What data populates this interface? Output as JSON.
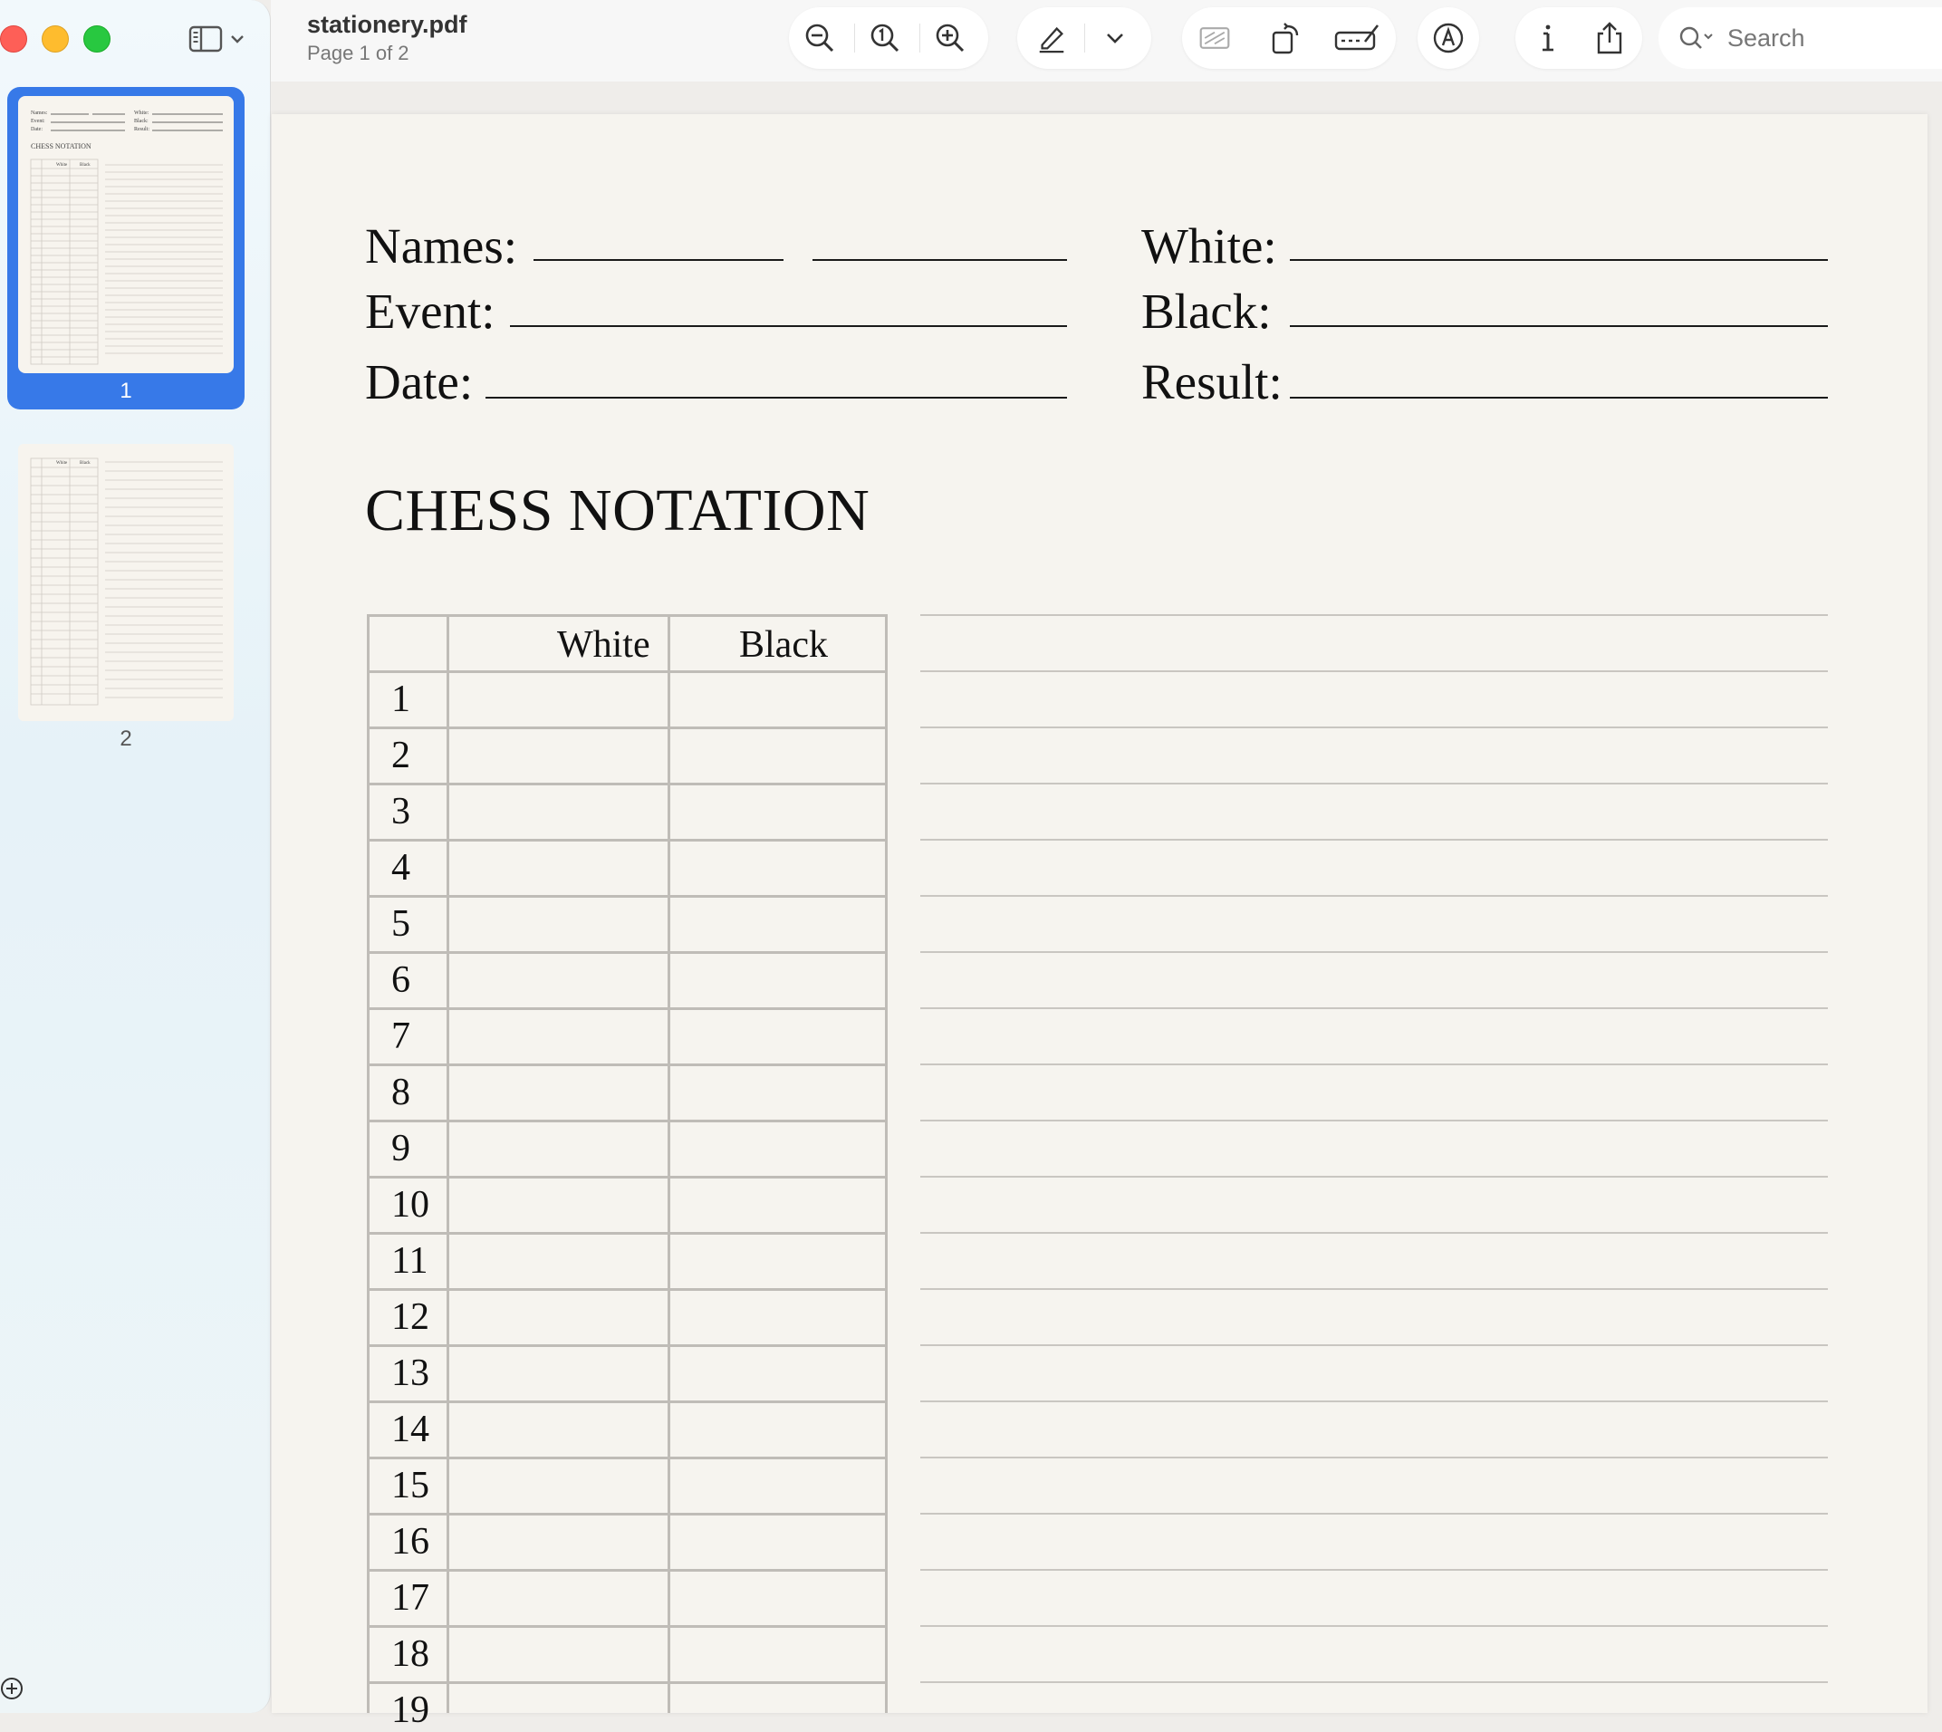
{
  "toolbar": {
    "file_name": "stationery.pdf",
    "page_indicator": "Page 1 of 2",
    "search_placeholder": "Search",
    "icons": [
      "zoom-out-icon",
      "actual-size-icon",
      "zoom-in-icon",
      "highlight-pen-icon",
      "chevron-down-icon",
      "crop-icon",
      "rotate-icon",
      "form-fill-icon",
      "markup-icon",
      "info-icon",
      "share-icon",
      "search-icon"
    ]
  },
  "sidebar": {
    "thumbnails": [
      {
        "label": "1",
        "selected": true
      },
      {
        "label": "2",
        "selected": false
      }
    ]
  },
  "page": {
    "fields_left": [
      {
        "label": "Names:"
      },
      {
        "label": "Event:"
      },
      {
        "label": "Date:"
      }
    ],
    "fields_right": [
      {
        "label": "White:"
      },
      {
        "label": "Black:"
      },
      {
        "label": "Result:"
      }
    ],
    "heading": "CHESS NOTATION",
    "table": {
      "columns": [
        "",
        "White",
        "Black"
      ],
      "rows": [
        "1",
        "2",
        "3",
        "4",
        "5",
        "6",
        "7",
        "8",
        "9",
        "10",
        "11",
        "12",
        "13",
        "14",
        "15",
        "16",
        "17",
        "18",
        "19"
      ]
    }
  }
}
